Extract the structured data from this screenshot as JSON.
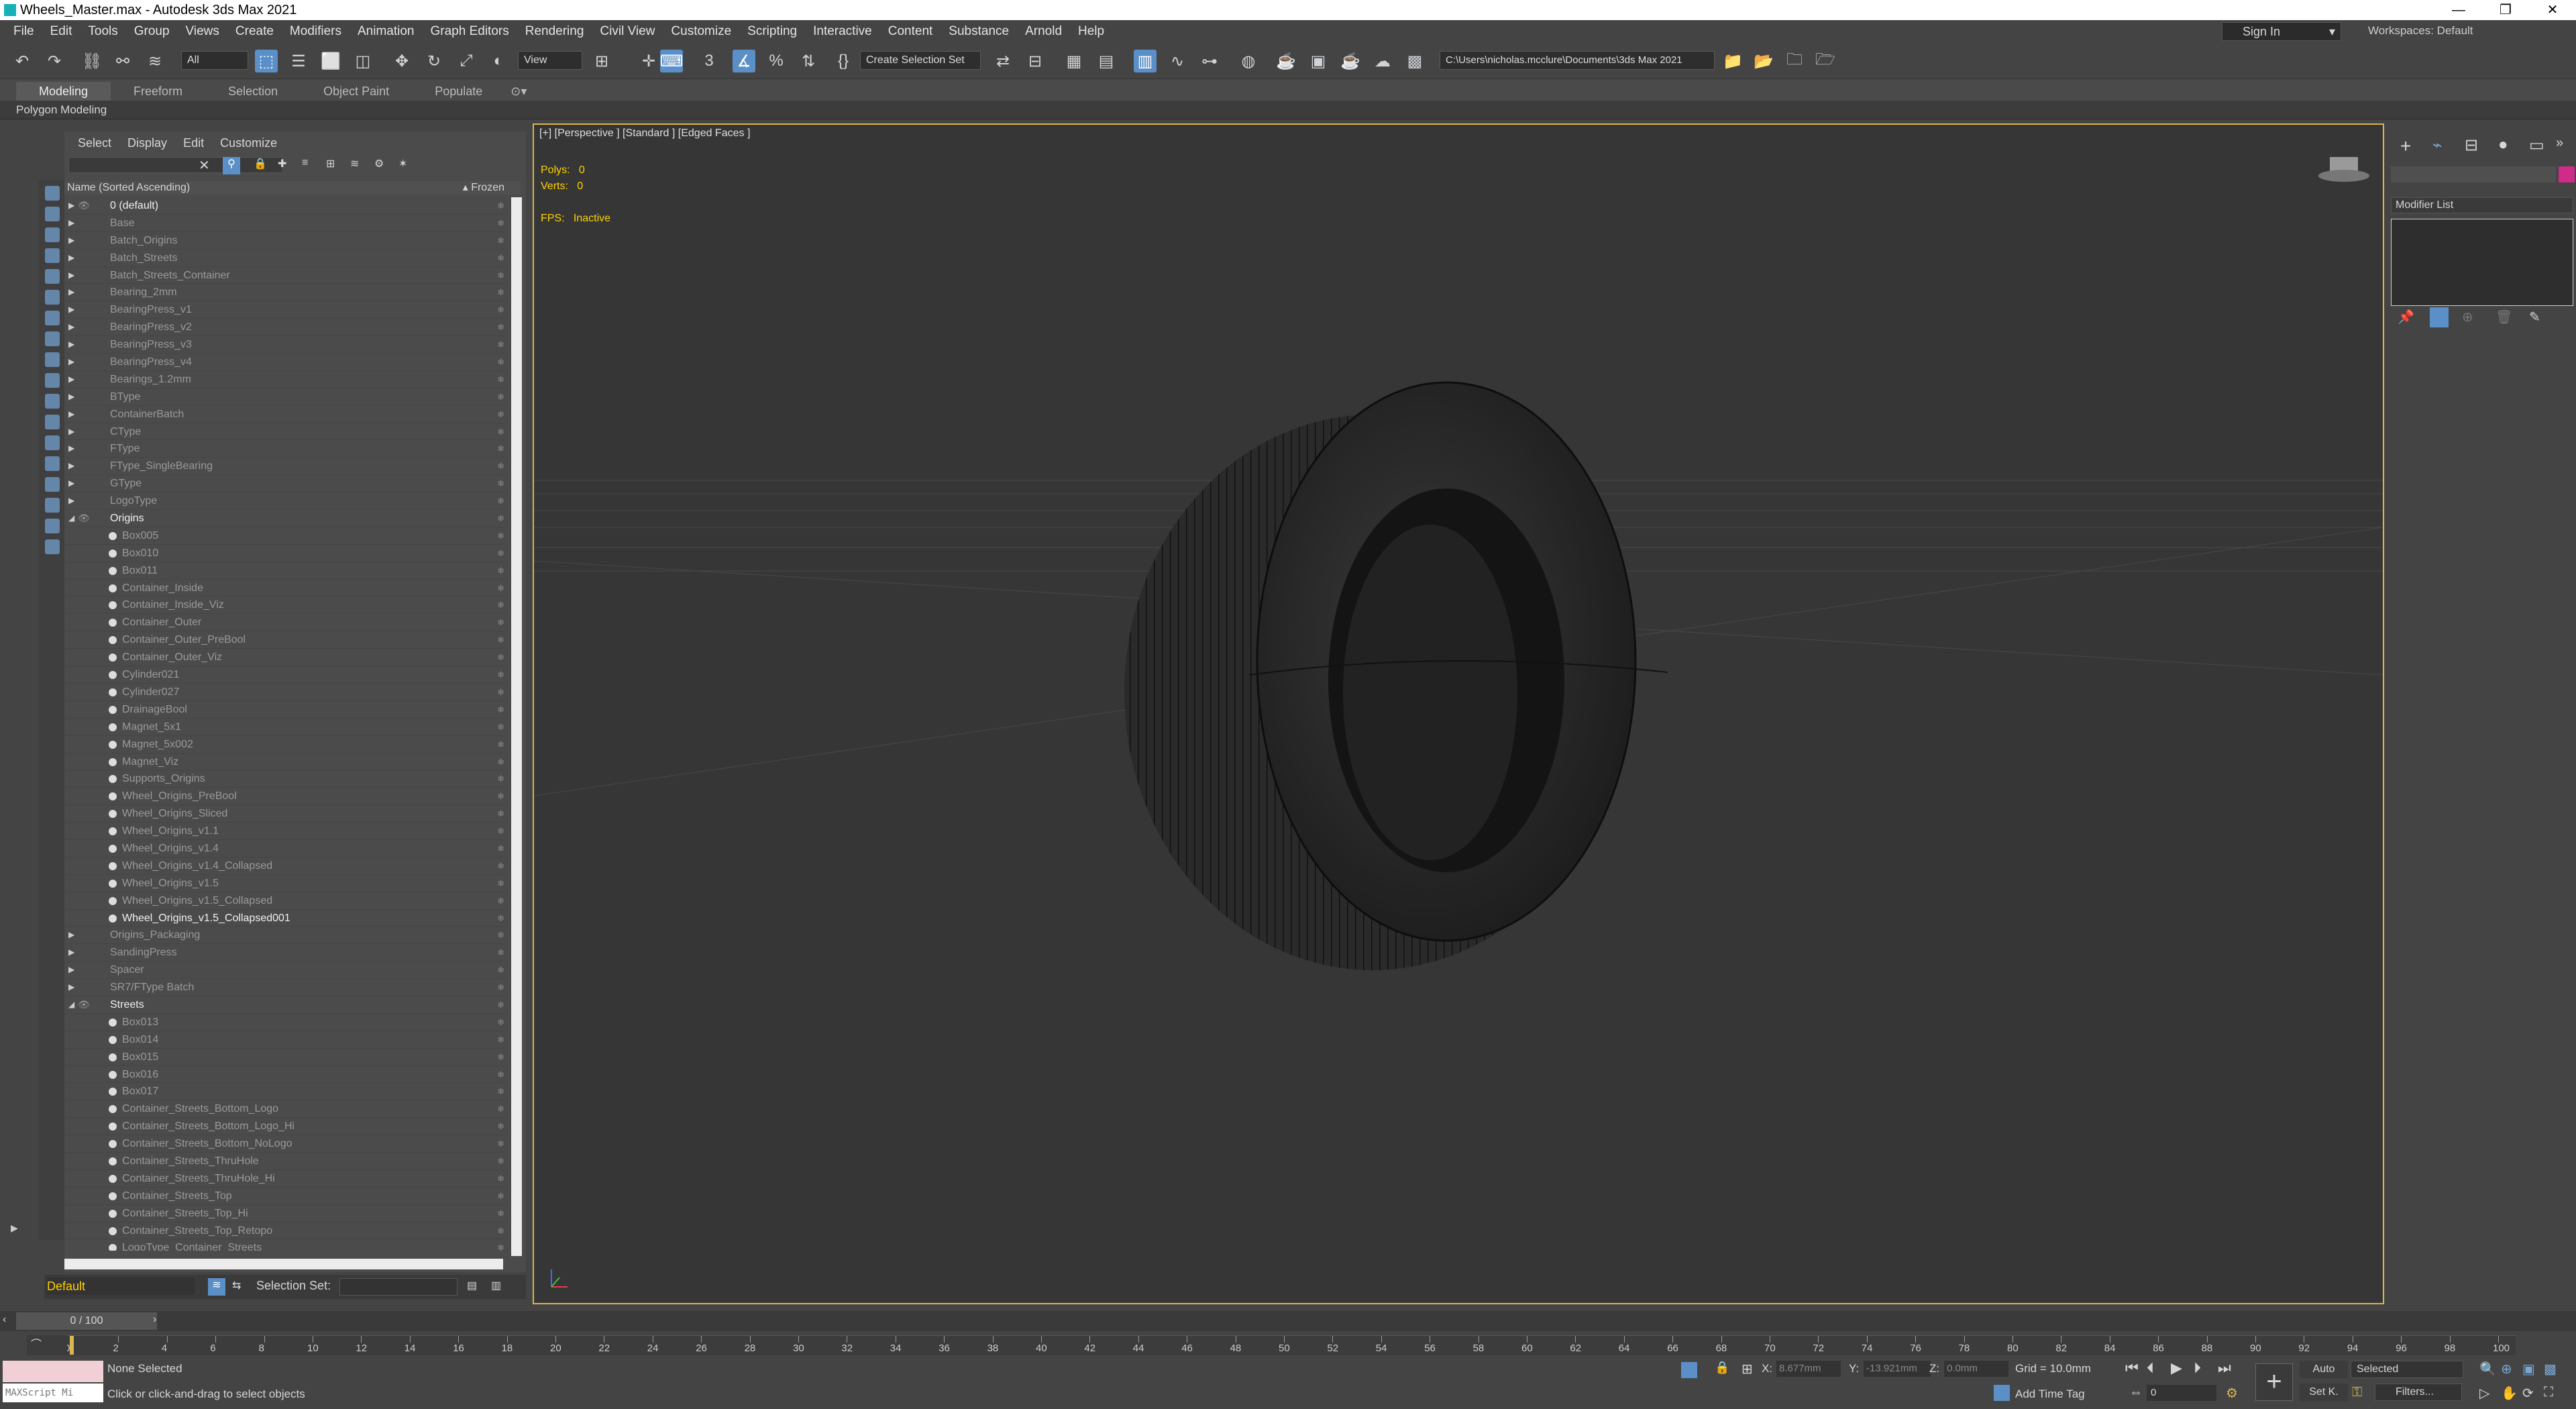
{
  "window": {
    "title": "Wheels_Master.max - Autodesk 3ds Max 2021",
    "buttons": [
      "—",
      "❐",
      "✕"
    ]
  },
  "menu": [
    "File",
    "Edit",
    "Tools",
    "Group",
    "Views",
    "Create",
    "Modifiers",
    "Animation",
    "Graph Editors",
    "Rendering",
    "Civil View",
    "Customize",
    "Scripting",
    "Interactive",
    "Content",
    "Substance",
    "Arnold",
    "Help"
  ],
  "signin": "Sign In",
  "workspaces": "Workspaces: Default",
  "toolbar": {
    "filter": "All",
    "refcoord": "View",
    "selection_set": "Create Selection Set",
    "path": "C:\\Users\\nicholas.mcclure\\Documents\\3ds Max 2021"
  },
  "ribbon": {
    "tabs": [
      "Modeling",
      "Freeform",
      "Selection",
      "Object Paint",
      "Populate"
    ],
    "panel": "Polygon Modeling"
  },
  "explorer": {
    "menu": [
      "Select",
      "Display",
      "Edit",
      "Customize"
    ],
    "column": "Name (Sorted Ascending)",
    "frozen": "▴ Frozen",
    "rows": [
      {
        "t": "layer",
        "n": "0 (default)",
        "a": true
      },
      {
        "t": "layer",
        "n": "Base"
      },
      {
        "t": "layer",
        "n": "Batch_Origins"
      },
      {
        "t": "layer",
        "n": "Batch_Streets"
      },
      {
        "t": "layer",
        "n": "Batch_Streets_Container"
      },
      {
        "t": "layer",
        "n": "Bearing_2mm"
      },
      {
        "t": "layer",
        "n": "BearingPress_v1"
      },
      {
        "t": "layer",
        "n": "BearingPress_v2"
      },
      {
        "t": "layer",
        "n": "BearingPress_v3"
      },
      {
        "t": "layer",
        "n": "BearingPress_v4"
      },
      {
        "t": "layer",
        "n": "Bearings_1.2mm"
      },
      {
        "t": "layer",
        "n": "BType"
      },
      {
        "t": "layer",
        "n": "ContainerBatch"
      },
      {
        "t": "layer",
        "n": "CType"
      },
      {
        "t": "layer",
        "n": "FType"
      },
      {
        "t": "layer",
        "n": "FType_SingleBearing"
      },
      {
        "t": "layer",
        "n": "GType"
      },
      {
        "t": "layer",
        "n": "LogoType"
      },
      {
        "t": "layer",
        "n": "Origins",
        "a": true,
        "open": true
      },
      {
        "t": "child",
        "n": "Box005"
      },
      {
        "t": "child",
        "n": "Box010"
      },
      {
        "t": "child",
        "n": "Box011"
      },
      {
        "t": "child",
        "n": "Container_Inside"
      },
      {
        "t": "child",
        "n": "Container_Inside_Viz"
      },
      {
        "t": "child",
        "n": "Container_Outer"
      },
      {
        "t": "child",
        "n": "Container_Outer_PreBool"
      },
      {
        "t": "child",
        "n": "Container_Outer_Viz"
      },
      {
        "t": "child",
        "n": "Cylinder021"
      },
      {
        "t": "child",
        "n": "Cylinder027"
      },
      {
        "t": "child",
        "n": "DrainageBool"
      },
      {
        "t": "child",
        "n": "Magnet_5x1"
      },
      {
        "t": "child",
        "n": "Magnet_5x002"
      },
      {
        "t": "child",
        "n": "Magnet_Viz"
      },
      {
        "t": "child",
        "n": "Supports_Origins"
      },
      {
        "t": "child",
        "n": "Wheel_Origins_PreBool"
      },
      {
        "t": "child",
        "n": "Wheel_Origins_Sliced"
      },
      {
        "t": "child",
        "n": "Wheel_Origins_v1.1"
      },
      {
        "t": "child",
        "n": "Wheel_Origins_v1.4"
      },
      {
        "t": "child",
        "n": "Wheel_Origins_v1.4_Collapsed"
      },
      {
        "t": "child",
        "n": "Wheel_Origins_v1.5"
      },
      {
        "t": "child",
        "n": "Wheel_Origins_v1.5_Collapsed"
      },
      {
        "t": "child",
        "n": "Wheel_Origins_v1.5_Collapsed001",
        "a": true
      },
      {
        "t": "layer",
        "n": "Origins_Packaging"
      },
      {
        "t": "layer",
        "n": "SandingPress"
      },
      {
        "t": "layer",
        "n": "Spacer"
      },
      {
        "t": "layer",
        "n": "SR7/FType Batch"
      },
      {
        "t": "layer",
        "n": "Streets",
        "a": true,
        "open": true
      },
      {
        "t": "child",
        "n": "Box013"
      },
      {
        "t": "child",
        "n": "Box014"
      },
      {
        "t": "child",
        "n": "Box015"
      },
      {
        "t": "child",
        "n": "Box016"
      },
      {
        "t": "child",
        "n": "Box017"
      },
      {
        "t": "child",
        "n": "Container_Streets_Bottom_Logo"
      },
      {
        "t": "child",
        "n": "Container_Streets_Bottom_Logo_Hi"
      },
      {
        "t": "child",
        "n": "Container_Streets_Bottom_NoLogo"
      },
      {
        "t": "child",
        "n": "Container_Streets_ThruHole"
      },
      {
        "t": "child",
        "n": "Container_Streets_ThruHole_Hi"
      },
      {
        "t": "child",
        "n": "Container_Streets_Top"
      },
      {
        "t": "child",
        "n": "Container_Streets_Top_Hi"
      },
      {
        "t": "child",
        "n": "Container_Streets_Top_Retopo"
      },
      {
        "t": "child",
        "n": "LogoType_Container_Streets"
      }
    ]
  },
  "layerbar": {
    "layer": "Default",
    "selection_set_label": "Selection Set:"
  },
  "viewport": {
    "label": "[+] [Perspective ] [Standard ] [Edged Faces ]",
    "polys_label": "Polys:",
    "polys": "0",
    "verts_label": "Verts:",
    "verts": "0",
    "fps_label": "FPS:",
    "fps": "Inactive"
  },
  "cmdpanel": {
    "modifier_list": "Modifier List"
  },
  "timeslider": {
    "frame": "0 / 100",
    "ticks": [
      "0",
      "2",
      "4",
      "6",
      "8",
      "10",
      "12",
      "14",
      "16",
      "18",
      "20",
      "22",
      "24",
      "26",
      "28",
      "30",
      "32",
      "34",
      "36",
      "38",
      "40",
      "42",
      "44",
      "46",
      "48",
      "50",
      "52",
      "54",
      "56",
      "58",
      "60",
      "62",
      "64",
      "66",
      "68",
      "70",
      "72",
      "74",
      "76",
      "78",
      "80",
      "82",
      "84",
      "86",
      "88",
      "90",
      "92",
      "94",
      "96",
      "98",
      "100"
    ]
  },
  "status": {
    "maxscript": "MAXScript Mi",
    "selection": "None Selected",
    "prompt": "Click or click-and-drag to select objects",
    "x_label": "X:",
    "x": "8.677mm",
    "y_label": "Y:",
    "y": "-13.921mm",
    "z_label": "Z:",
    "z": "0.0mm",
    "grid": "Grid = 10.0mm",
    "add_time_tag": "Add Time Tag",
    "auto": "Auto",
    "selected": "Selected",
    "set_key": "Set K.",
    "filters": "Filters...",
    "frame_field": "0"
  }
}
